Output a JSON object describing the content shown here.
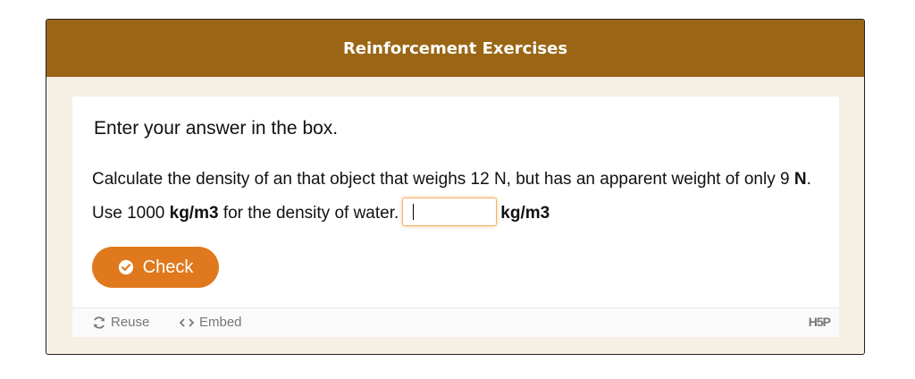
{
  "header": {
    "title": "Reinforcement Exercises"
  },
  "question": {
    "instructions": "Enter your answer in the box.",
    "text_part1": "Calculate the density of an that object that weighs 12 N, but has an apparent weight of only 9 ",
    "text_bold1": "N",
    "text_part2": ". Use 1000 ",
    "text_bold2": "kg/m3",
    "text_part3": " for the density of water.",
    "answer_value": "",
    "unit_label": "kg/m3"
  },
  "actions": {
    "check_label": "Check"
  },
  "footer": {
    "reuse_label": "Reuse",
    "embed_label": "Embed",
    "logo_text": "H5P"
  },
  "colors": {
    "header": "#9a6616",
    "accent": "#e0781d",
    "frame_bg": "#f6efe4"
  },
  "icons": {
    "check": "check-circle-icon",
    "reuse": "refresh-icon",
    "embed": "code-icon"
  }
}
